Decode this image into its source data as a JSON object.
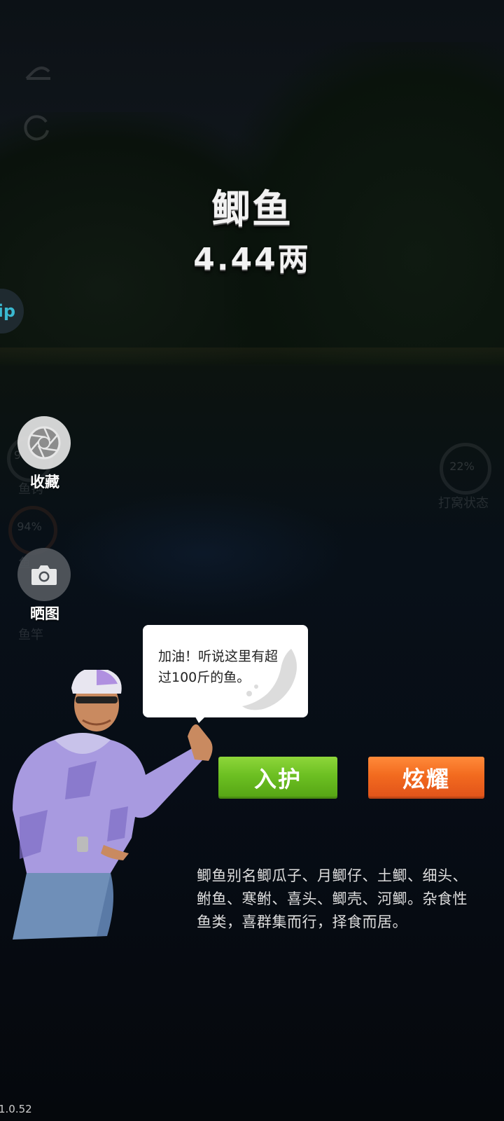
{
  "fish": {
    "name": "鲫鱼",
    "weight": "4.44两"
  },
  "side_buttons": {
    "favorite_label": "收藏",
    "share_image_label": "晒图"
  },
  "background_hud": {
    "ring_1_percent": "9",
    "ring_1_label": "鱼钩",
    "ring_2_percent": "94%",
    "ring_2_label": "鱼",
    "ring_3_label": "鱼竿",
    "ring_right_percent": "22%",
    "ring_right_label": "打窝状态",
    "app_badge_text": "ip"
  },
  "speech_bubble": {
    "text_line1": "加油！听说这里有超",
    "text_line2": "过100斤的鱼。"
  },
  "actions": {
    "release_label": "入护",
    "show_off_label": "炫耀"
  },
  "description": {
    "line1": "鲫鱼别名鲫瓜子、月鲫仔、土鲫、细头、",
    "line2": "鲋鱼、寒鲋、喜头、鲫壳、河鲫。杂食性",
    "line3": "鱼类，喜群集而行，择食而居。"
  },
  "version": "1.0.52",
  "colors": {
    "release_button": "#6cbf22",
    "show_off_button": "#f26a1f",
    "background": "#05080c"
  },
  "icons": {
    "favorite": "aperture-icon",
    "share_image": "camera-icon",
    "back": "back-icon",
    "refresh": "refresh-icon"
  }
}
